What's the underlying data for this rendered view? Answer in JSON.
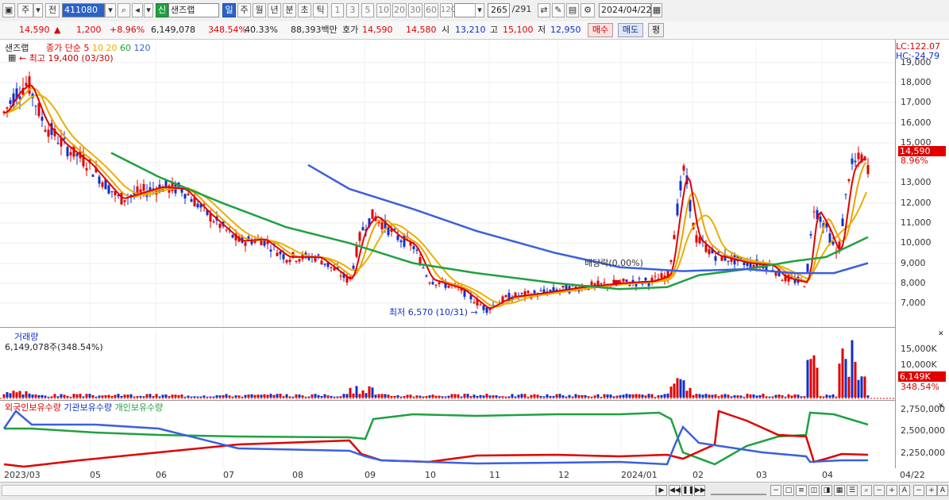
{
  "toolbar": {
    "market": "주",
    "prev_label": "전",
    "code": "411080",
    "shin": "신",
    "stock_name": "샌즈랩",
    "periods": [
      "일",
      "주",
      "월",
      "년",
      "분",
      "초",
      "틱"
    ],
    "ticks": [
      "1",
      "3",
      "5",
      "10",
      "20",
      "30",
      "60",
      "120"
    ],
    "count": "265",
    "total": "/291",
    "date": "2024/04/22"
  },
  "quote": {
    "price": "14,590",
    "change_arrow": "▲",
    "change": "1,200",
    "change_pct": "+8.96%",
    "volume": "6,149,078",
    "vol_ratio": "348.54%",
    "turnover": "40.33%",
    "amount": "88,393백만",
    "hoga_label": "호가",
    "ask": "14,590",
    "bid": "14,580",
    "open_label": "시",
    "open": "13,210",
    "high_label": "고",
    "high": "15,100",
    "low_label": "저",
    "low": "12,950",
    "buy": "매수",
    "sell": "매도",
    "avg": "평"
  },
  "price_panel": {
    "name": "샌즈랩",
    "ma_label": "종가 단순",
    "ma_periods": [
      "5",
      "10",
      "20",
      "60",
      "120"
    ],
    "lc": "LC:122.07",
    "hc": "HC:-24.79",
    "high_note": "최고 19,400 (03/30)",
    "low_note": "최저 6,570 (10/31)",
    "div_note": "배당락(0.00%)",
    "last_price_tag": "14,590",
    "last_pct_tag": "8.96%",
    "y_ticks": [
      "19,000",
      "18,000",
      "17,000",
      "16,000",
      "15,000",
      "13,000",
      "12,000",
      "11,000",
      "10,000",
      "9,000",
      "8,000",
      "7,000"
    ]
  },
  "volume_panel": {
    "title": "거래량",
    "value": "6,149,078주(348.54%)",
    "y_ticks": [
      "15,000K",
      "10,000K",
      "5,000K"
    ],
    "last_tag": "6,149K",
    "last_pct": "348.54%"
  },
  "holding_panel": {
    "foreign": "외국인보유수량",
    "inst": "기관보유수량",
    "indiv": "개인보유수량",
    "y_ticks": [
      "2,750,000",
      "2,500,000",
      "2,250,000"
    ]
  },
  "x_axis": [
    "2023/03",
    "05",
    "06",
    "07",
    "08",
    "09",
    "10",
    "11",
    "12",
    "2024/01",
    "02",
    "03",
    "04",
    "04/22"
  ],
  "colors": {
    "up": "#e00000",
    "down": "#1030c8",
    "ma5": "#e00000",
    "ma10": "#f0a000",
    "ma20": "#e8b000",
    "ma60": "#20a040",
    "ma120": "#3a60e0"
  }
}
